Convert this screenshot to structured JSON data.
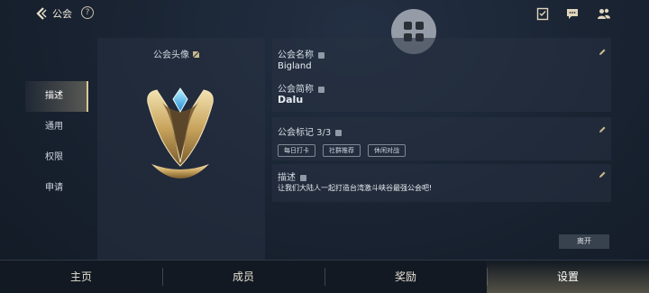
{
  "header": {
    "title": "公会",
    "help_symbol": "?"
  },
  "left_tabs": [
    {
      "label": "描述",
      "active": true
    },
    {
      "label": "通用",
      "active": false
    },
    {
      "label": "权限",
      "active": false
    },
    {
      "label": "申请",
      "active": false
    }
  ],
  "avatar": {
    "label": "公会头像"
  },
  "info": {
    "name_label": "公会名称",
    "name_value": "Bigland",
    "short_label": "公会简称",
    "short_value": "Dalu"
  },
  "tags": {
    "label": "公会标记 3/3",
    "items": [
      "每日打卡",
      "社群推荐",
      "休闲对战"
    ]
  },
  "description": {
    "label": "描述",
    "text": "让我们大陆人一起打造台湾激斗峡谷最强公会吧!"
  },
  "leave_button": "离开",
  "bottom_nav": [
    {
      "label": "主页",
      "active": false
    },
    {
      "label": "成员",
      "active": false
    },
    {
      "label": "奖励",
      "active": false
    },
    {
      "label": "设置",
      "active": true
    }
  ],
  "colors": {
    "accent_gold": "#d8c79a",
    "emblem_gem": "#4fd2ff"
  }
}
